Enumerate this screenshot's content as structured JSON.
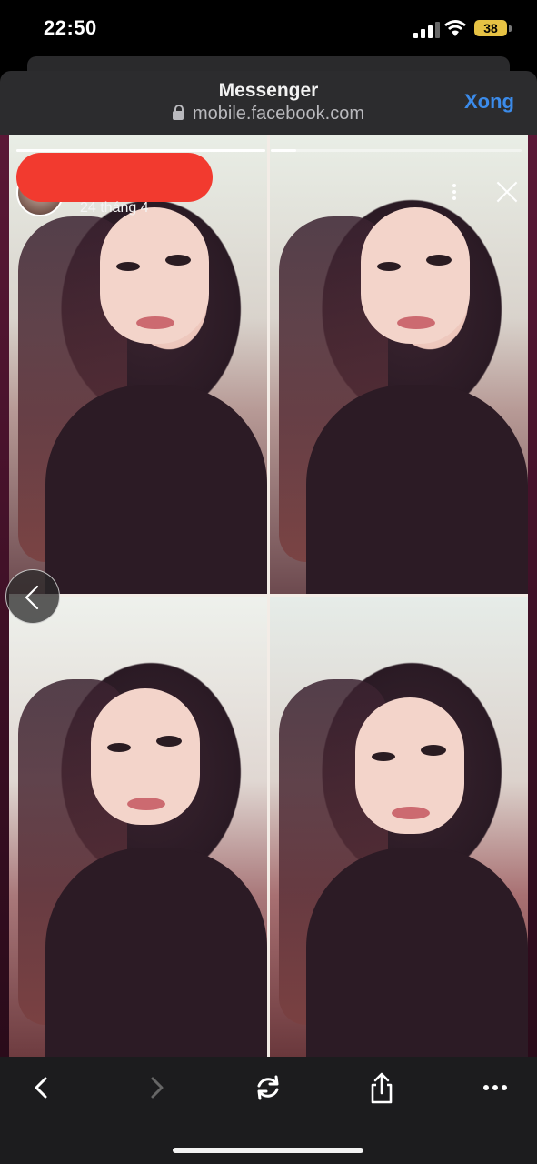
{
  "status_bar": {
    "time": "22:50",
    "battery": "38",
    "icons": [
      "cellular-signal-icon",
      "wifi-icon",
      "battery-icon"
    ]
  },
  "browser": {
    "title": "Messenger",
    "url": "mobile.facebook.com",
    "done_label": "Xong",
    "accent_color": "#3b8bea"
  },
  "story": {
    "date": "24 tháng 4",
    "progress_fraction": [
      1.0,
      0.1
    ],
    "redaction_color": "#f23a2f",
    "icons": [
      "more-options-icon",
      "close-icon",
      "previous-story-icon"
    ]
  },
  "toolbar": {
    "icons": [
      "back-icon",
      "forward-icon",
      "reload-icon",
      "share-icon",
      "more-icon"
    ]
  }
}
